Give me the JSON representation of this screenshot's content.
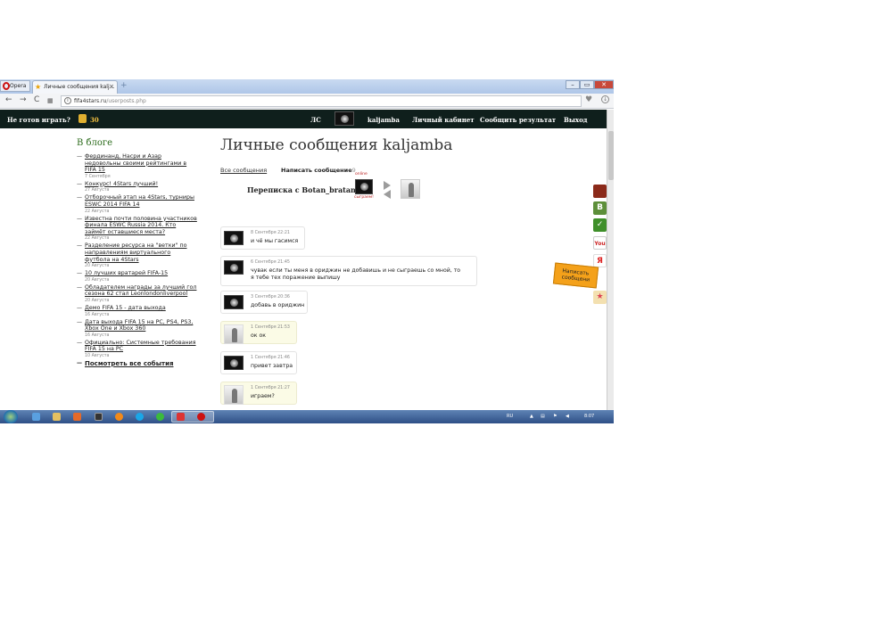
{
  "browser": {
    "app_button": "Opera",
    "tab_title": "Личные сообщения kalj...",
    "url_host": "fifa4stars.ru",
    "url_path": "/userposts.php"
  },
  "header": {
    "not_ready": "Не готов играть?",
    "coins": "30",
    "ls": "ЛС",
    "username": "kaljamba",
    "cabinet": "Личный кабинет",
    "report": "Сообщить результат",
    "logout": "Выход"
  },
  "sidebar": {
    "title": "В блоге",
    "items": [
      {
        "title": "Фердинанд, Насри и Азар недовольны своими рейтингами в FIFA 15",
        "date": "7 Сентября"
      },
      {
        "title": "Конкурс! 4Stars лучший!",
        "date": "27 Августа"
      },
      {
        "title": "Отборочный этап на 4Stars, турниры ESWC 2014 FIFA 14",
        "date": "22 Августа"
      },
      {
        "title": "Известна почти половина участников финала ESWC Russia 2014. Кто займёт оставшиеся места?",
        "date": "22 Августа"
      },
      {
        "title": "Разделение ресурса на \"ветки\" по направлениям виртуального футбола на 4Stars",
        "date": "20 Августа"
      },
      {
        "title": "10 лучших вратарей FIFA-15",
        "date": "20 Августа"
      },
      {
        "title": "Обладателем награды за лучший гол сезона 62 стал Leonlondonliverpool",
        "date": "20 Августа"
      },
      {
        "title": "Демо FIFA 15 - дата выхода",
        "date": "16 Августа"
      },
      {
        "title": "Дата выхода FIFA 15 на PC, PS4, PS3, Xbox One и Xbox 360",
        "date": "16 Августа"
      },
      {
        "title": "Официально: Системные требования FIFA 15 на PC",
        "date": "10 Августа"
      }
    ],
    "see_all": "Посмотреть все события"
  },
  "main": {
    "title": "Личные сообщения kaljamba",
    "all_messages": "Все сообщения",
    "write_message": "Написать сообщение",
    "write_count": "9",
    "conversation_with": "Переписка с Botan_bratan",
    "online": "online",
    "play": "сыграем!",
    "messages": [
      {
        "date": "8 Сентября 22:21",
        "text": "и чё мы гасимся",
        "sender": "self"
      },
      {
        "date": "6 Сентября 21:45",
        "text": "чувак если ты меня в ориджин не добавишь и не сыграешь со мной, то\nя тебе тех поражение выпишу",
        "sender": "self"
      },
      {
        "date": "3 Сентября 20:36",
        "text": "добавь в ориджин",
        "sender": "self"
      },
      {
        "date": "1 Сентября 21:53",
        "text": "ок ок",
        "sender": "other"
      },
      {
        "date": "1 Сентября 21:46",
        "text": "привет завтра",
        "sender": "self"
      },
      {
        "date": "1 Сентября 21:27",
        "text": "играем?",
        "sender": "other"
      }
    ]
  },
  "social": {
    "write_tab": "Написать сообщени"
  },
  "taskbar": {
    "lang": "RU",
    "clock": "8:07"
  },
  "colors": {
    "header_bg": "#0f1f1c",
    "sidebar_title": "#2a6a1a",
    "coins": "#f2c040",
    "write_tab": "#f4a11a"
  }
}
